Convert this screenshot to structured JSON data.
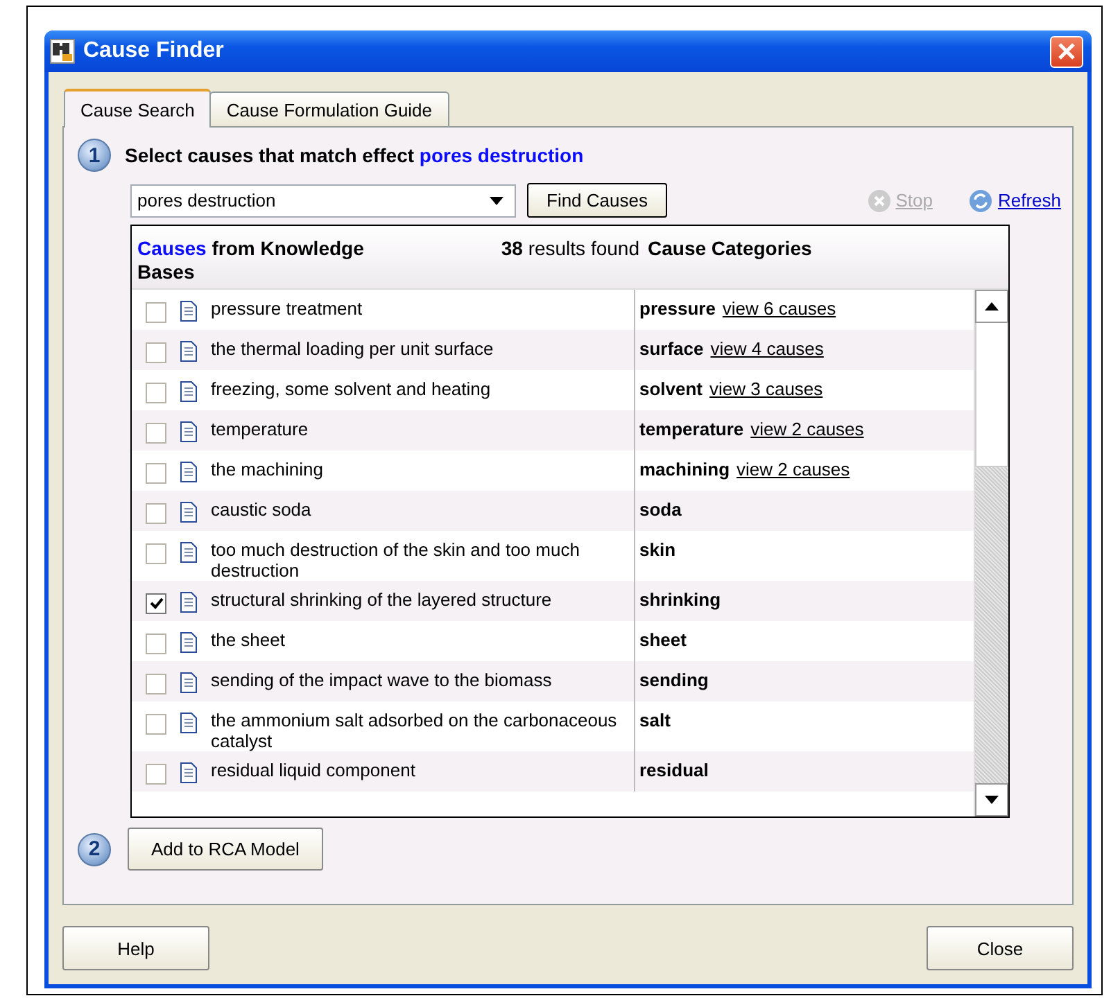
{
  "window": {
    "title": "Cause Finder"
  },
  "tabs": [
    {
      "label": "Cause Search",
      "selected": true
    },
    {
      "label": "Cause Formulation Guide",
      "selected": false
    }
  ],
  "step1": {
    "number": "1",
    "text": "Select causes that match effect",
    "effect": "pores destruction"
  },
  "search": {
    "value": "pores destruction",
    "find_button": "Find Causes",
    "stop": {
      "label": "Stop",
      "disabled": true
    },
    "refresh": {
      "label": "Refresh",
      "disabled": false
    }
  },
  "results": {
    "header_link": "Causes",
    "header_text": "from Knowledge Bases",
    "count": "**38** results found",
    "categories_header": "Cause Categories",
    "rows": [
      {
        "cause": "pressure treatment",
        "checked": false,
        "category": "pressure",
        "link": "view 6 causes"
      },
      {
        "cause": "the thermal loading per unit surface",
        "checked": false,
        "category": "surface",
        "link": "view 4 causes"
      },
      {
        "cause": "freezing, some solvent and heating",
        "checked": false,
        "category": "solvent",
        "link": "view 3 causes"
      },
      {
        "cause": "temperature",
        "checked": false,
        "category": "temperature",
        "link": "view 2 causes"
      },
      {
        "cause": "the machining",
        "checked": false,
        "category": "machining",
        "link": "view 2 causes"
      },
      {
        "cause": "caustic soda",
        "checked": false,
        "category": "soda"
      },
      {
        "cause": "too much destruction of the skin and too much destruction",
        "checked": false,
        "category": "skin"
      },
      {
        "cause": "structural shrinking of the layered structure",
        "checked": true,
        "category": "shrinking"
      },
      {
        "cause": "the sheet",
        "checked": false,
        "category": "sheet"
      },
      {
        "cause": "sending of the impact wave to the biomass",
        "checked": false,
        "category": "sending"
      },
      {
        "cause": "the ammonium salt adsorbed on the carbonaceous catalyst",
        "checked": false,
        "category": "salt"
      },
      {
        "cause": "residual liquid component",
        "checked": false,
        "category": "residual"
      }
    ]
  },
  "step2": {
    "number": "2",
    "button": "Add to RCA Model"
  },
  "footer": {
    "help": "Help",
    "close": "Close"
  }
}
